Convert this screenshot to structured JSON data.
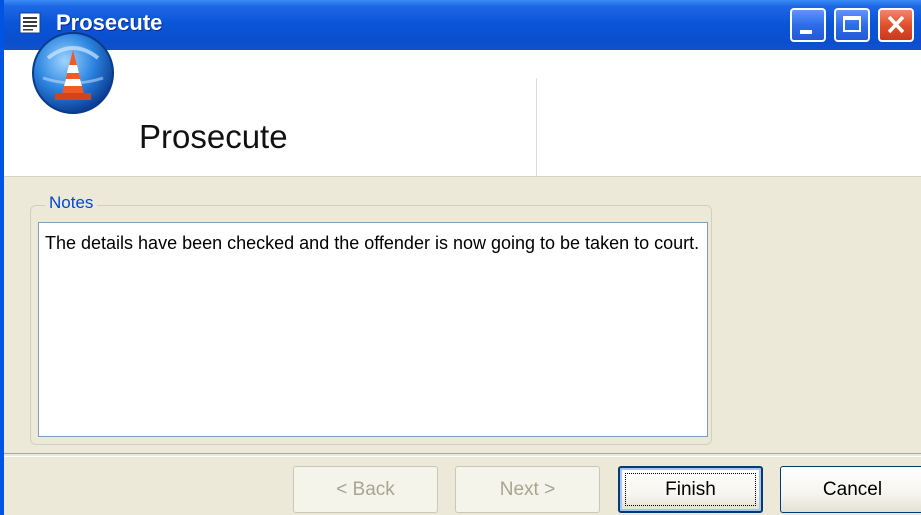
{
  "window": {
    "title": "Prosecute",
    "controls": {
      "minimize": "minimize",
      "maximize": "maximize",
      "close": "close"
    }
  },
  "header": {
    "title": "Prosecute",
    "logo_icon": "traffic-cone-icon"
  },
  "notes": {
    "label": "Notes",
    "value": "The details have been checked and the offender is now going to be taken to court."
  },
  "buttons": {
    "back": "< Back",
    "next": "Next >",
    "finish": "Finish",
    "cancel": "Cancel"
  },
  "colors": {
    "titlebar": "#0a55d8",
    "close_button": "#e1502c",
    "group_label": "#0046d5",
    "dialog_background": "#ece9d8"
  }
}
